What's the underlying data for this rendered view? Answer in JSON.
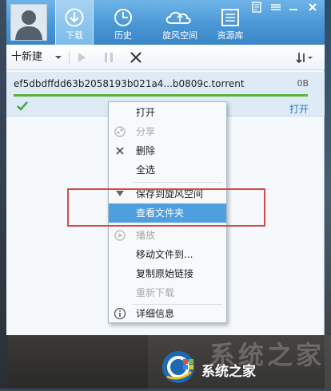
{
  "tabs": [
    {
      "label": "下载",
      "icon": "download-icon",
      "active": true
    },
    {
      "label": "历史",
      "icon": "history-clock-icon",
      "active": false
    },
    {
      "label": "旋风空间",
      "icon": "cloud-space-icon",
      "active": false
    },
    {
      "label": "资源库",
      "icon": "resource-library-icon",
      "active": false
    }
  ],
  "toolbar": {
    "new_label": "十新建"
  },
  "task": {
    "filename": "ef5dbdffdd63b2058193b021a4...b0809c.torrent",
    "size": "0B",
    "open_label": "打开",
    "progress": 1.0
  },
  "context_menu": {
    "items": [
      {
        "label": "打开",
        "icon": "",
        "disabled": false
      },
      {
        "label": "分享",
        "icon": "share-icon",
        "disabled": true
      },
      {
        "label": "删除",
        "icon": "delete-x-icon",
        "disabled": false
      },
      {
        "label": "全选",
        "icon": "",
        "disabled": false
      },
      {
        "label": "保存到旋风空间",
        "icon": "save-down-arrow-icon",
        "disabled": false
      },
      {
        "label": "查看文件夹",
        "icon": "",
        "disabled": false,
        "highlighted": true
      },
      {
        "label": "播放",
        "icon": "play-icon",
        "disabled": true
      },
      {
        "label": "移动文件到...",
        "icon": "",
        "disabled": false
      },
      {
        "label": "复制原始链接",
        "icon": "",
        "disabled": false
      },
      {
        "label": "重新下载",
        "icon": "",
        "disabled": true
      },
      {
        "label": "详细信息",
        "icon": "info-icon",
        "disabled": false
      }
    ]
  },
  "watermark": {
    "big_text": "系统之家",
    "text": "系统之家"
  },
  "colors": {
    "accent": "#4a97d6",
    "highlight": "#4f9ede",
    "progress": "#5ab435",
    "annotation": "#d44a4a"
  }
}
